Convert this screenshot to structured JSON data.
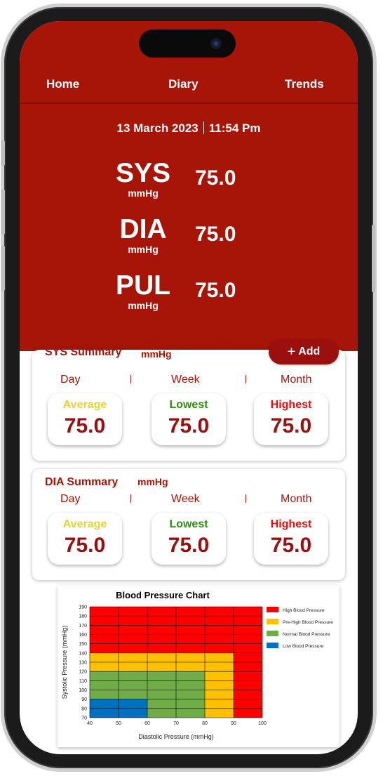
{
  "nav": {
    "home": "Home",
    "diary": "Diary",
    "trends": "Trends"
  },
  "datetime": {
    "date": "13 March 2023",
    "time": "11:54 Pm"
  },
  "readings": [
    {
      "label": "SYS",
      "unit": "mmHg",
      "value": "75.0"
    },
    {
      "label": "DIA",
      "unit": "mmHg",
      "value": "75.0"
    },
    {
      "label": "PUL",
      "unit": "mmHg",
      "value": "75.0"
    }
  ],
  "add_button": {
    "icon": "plus-icon",
    "label": "Add"
  },
  "sys_summary": {
    "title": "SYS Summary",
    "unit": "mmHg",
    "periods": [
      "Day",
      "Week",
      "Month"
    ],
    "stats": [
      {
        "label": "Average",
        "value": "75.0",
        "color": "#e0d43a"
      },
      {
        "label": "Lowest",
        "value": "75.0",
        "color": "#2e8b12"
      },
      {
        "label": "Highest",
        "value": "75.0",
        "color": "#e01010"
      }
    ]
  },
  "dia_summary": {
    "title": "DIA Summary",
    "unit": "mmHg",
    "periods": [
      "Day",
      "Week",
      "Month"
    ],
    "stats": [
      {
        "label": "Average",
        "value": "75.0",
        "color": "#e0d43a"
      },
      {
        "label": "Lowest",
        "value": "75.0",
        "color": "#2e8b12"
      },
      {
        "label": "Highest",
        "value": "75.0",
        "color": "#e01010"
      }
    ]
  },
  "colors": {
    "primary": "#a61507",
    "value": "#9a0f0f"
  },
  "chart_data": {
    "type": "heatmap",
    "title": "Blood Pressure Chart",
    "xlabel": "Diastolic Pressure (mmHg)",
    "ylabel": "Systolic Pressure (mmHg)",
    "x_ticks": [
      40,
      50,
      60,
      70,
      80,
      90,
      100
    ],
    "y_ticks": [
      70,
      80,
      90,
      100,
      110,
      120,
      130,
      140,
      150,
      160,
      170,
      180,
      190
    ],
    "xlim": [
      40,
      100
    ],
    "ylim": [
      70,
      190
    ],
    "legend": [
      {
        "name": "High Blood Pressure",
        "color": "#ff0000"
      },
      {
        "name": "Pre-High Blood Pressure",
        "color": "#ffc000"
      },
      {
        "name": "Normal Blood Pressure",
        "color": "#70ad47"
      },
      {
        "name": "Low Blood Pressure",
        "color": "#0070c0"
      }
    ],
    "regions": [
      {
        "category": "High Blood Pressure",
        "x": [
          40,
          100
        ],
        "y": [
          70,
          190
        ]
      },
      {
        "category": "Pre-High Blood Pressure",
        "x": [
          40,
          90
        ],
        "y": [
          70,
          140
        ]
      },
      {
        "category": "Normal Blood Pressure",
        "x": [
          40,
          80
        ],
        "y": [
          70,
          120
        ]
      },
      {
        "category": "Low Blood Pressure",
        "x": [
          40,
          60
        ],
        "y": [
          70,
          90
        ]
      }
    ],
    "legend_position": "right",
    "grid": true
  }
}
